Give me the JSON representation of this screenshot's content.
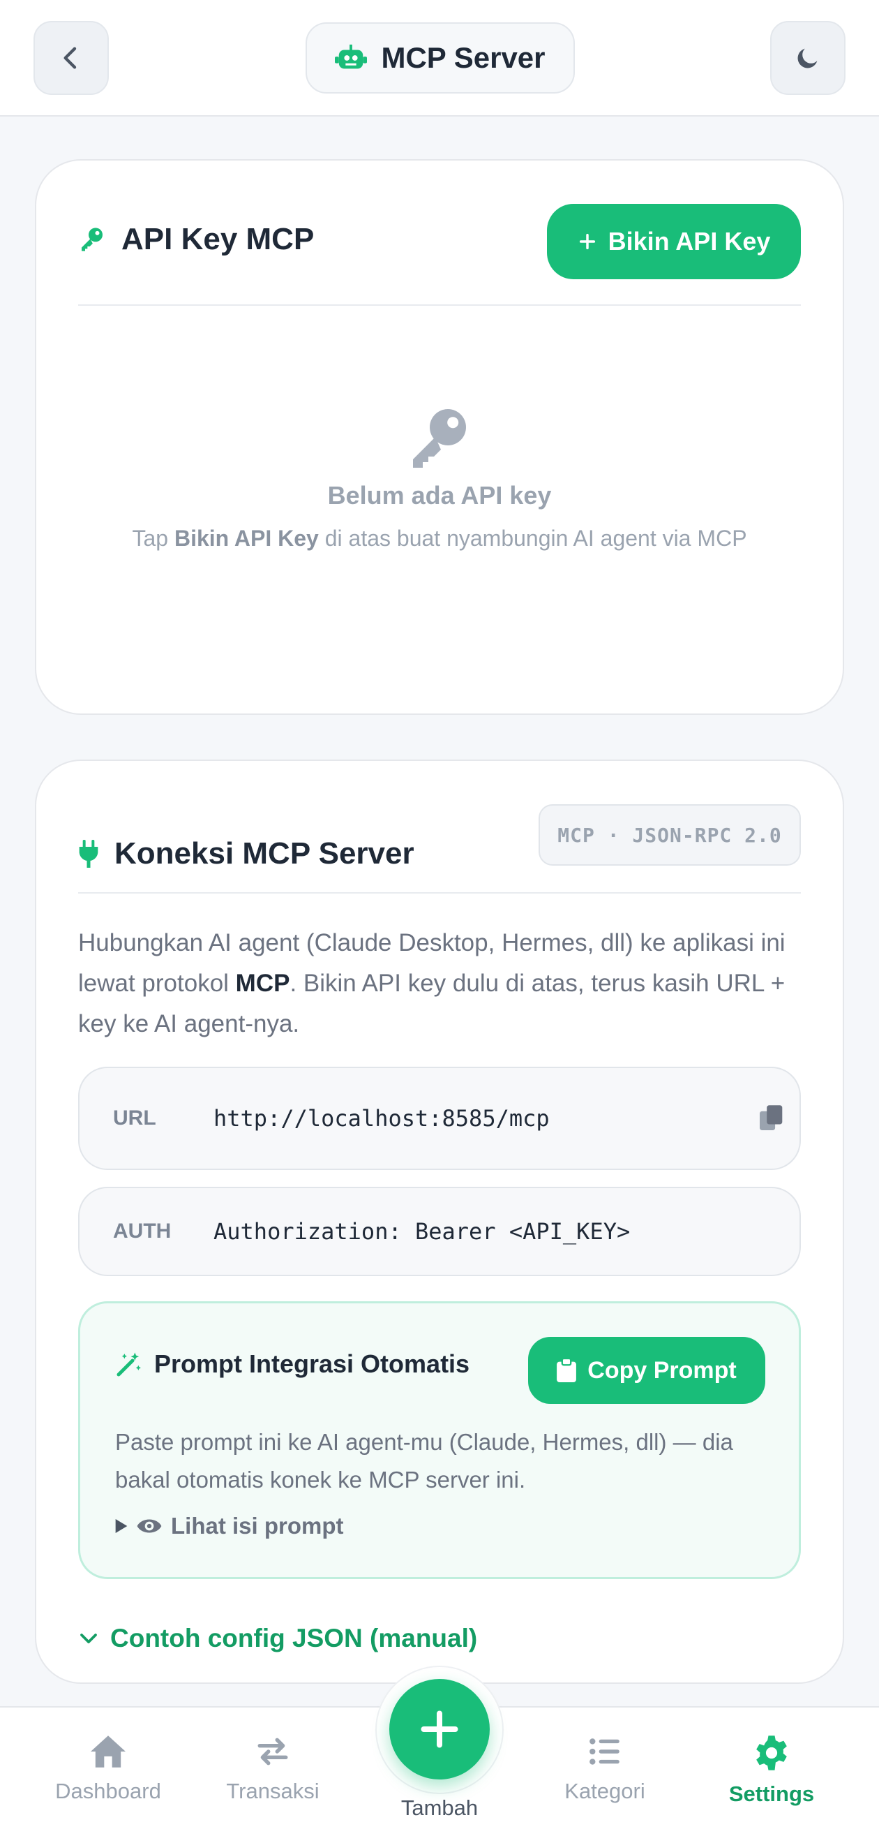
{
  "header": {
    "title": "MCP Server",
    "back_icon": "chevron-left-icon",
    "theme_icon": "moon-icon",
    "title_icon": "robot-icon"
  },
  "api_key_card": {
    "title": "API Key MCP",
    "create_button": "Bikin API Key",
    "empty_title": "Belum ada API key",
    "empty_sub_prefix": "Tap ",
    "empty_sub_bold": "Bikin API Key",
    "empty_sub_suffix": " di atas buat nyambungin AI agent via MCP"
  },
  "connection_card": {
    "title": "Koneksi MCP Server",
    "badge": "MCP · JSON-RPC 2.0",
    "desc_1": "Hubungkan AI agent (Claude Desktop, Hermes, dll) ke aplikasi ini lewat protokol ",
    "desc_bold": "MCP",
    "desc_2": ". Bikin API key dulu di atas, terus kasih URL + key ke AI agent-nya.",
    "url_label": "URL",
    "url_value": "http://localhost:8585/mcp",
    "auth_label": "AUTH",
    "auth_value": "Authorization: Bearer <API_KEY>",
    "prompt_title": "Prompt Integrasi Otomatis",
    "copy_prompt": "Copy Prompt",
    "prompt_desc": "Paste prompt ini ke AI agent-mu (Claude, Hermes, dll) — dia bakal otomatis konek ke MCP server ini.",
    "prompt_toggle": "Lihat isi prompt",
    "json_toggle": "Contoh config JSON (manual)"
  },
  "nav": {
    "items": [
      {
        "label": "Dashboard",
        "icon": "home-icon"
      },
      {
        "label": "Transaksi",
        "icon": "swap-icon"
      },
      {
        "label": "Tambah",
        "icon": "plus-icon"
      },
      {
        "label": "Kategori",
        "icon": "list-icon"
      },
      {
        "label": "Settings",
        "icon": "gear-icon"
      }
    ],
    "active": "Settings"
  },
  "colors": {
    "accent": "#19bd79",
    "accent_dark": "#139c63",
    "muted": "#9aa3af"
  }
}
